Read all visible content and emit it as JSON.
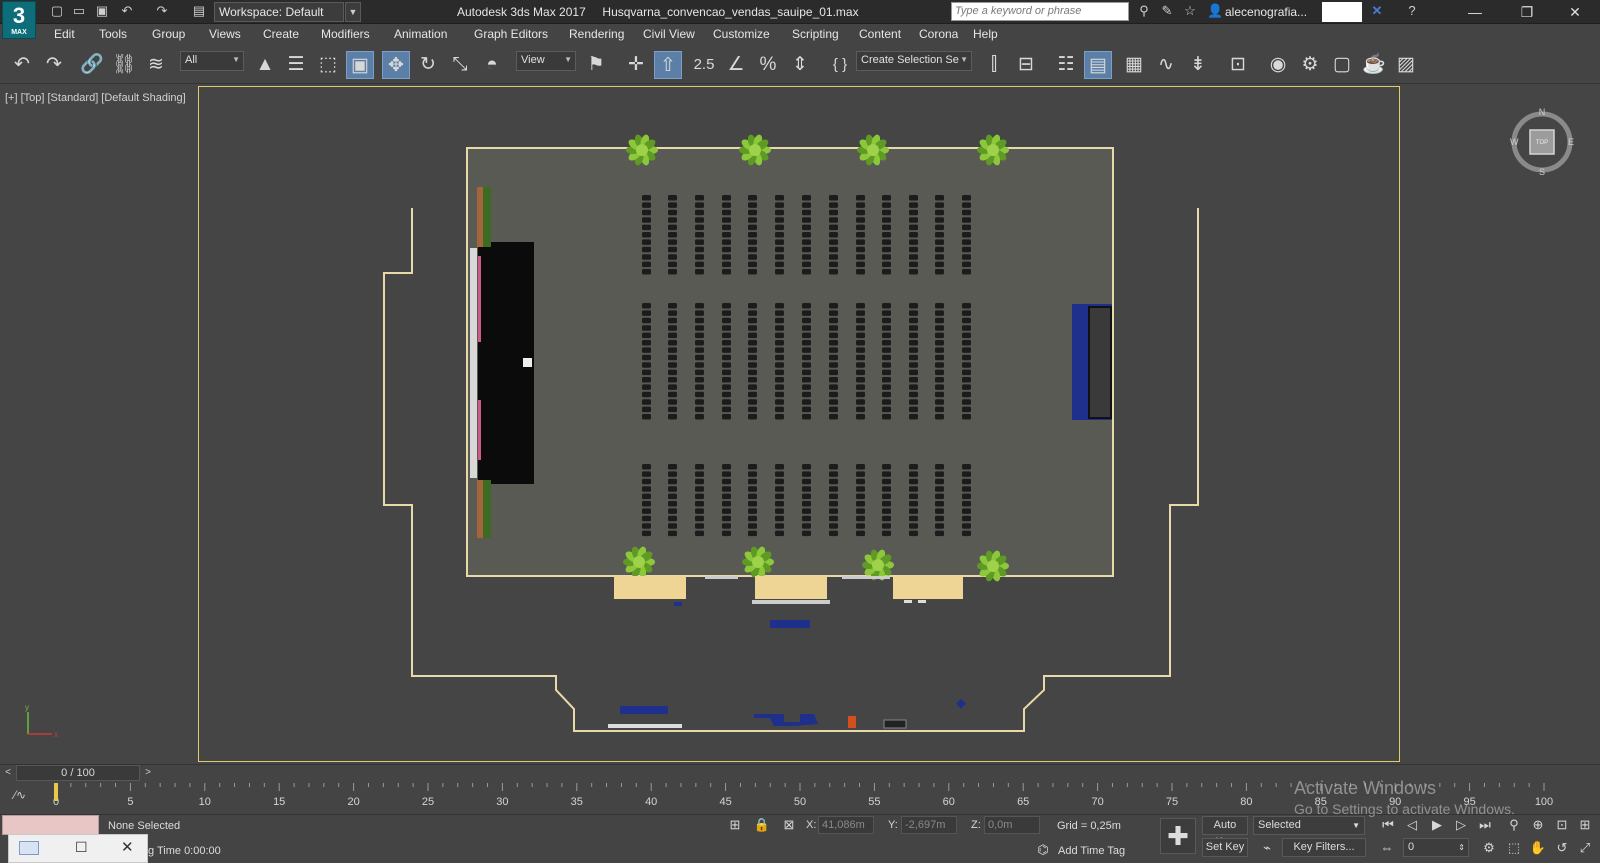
{
  "titlebar": {
    "logo_text": "3",
    "logo_sub": "MAX",
    "workspace": "Workspace: Default",
    "app_title": "Autodesk 3ds Max 2017     Husqvarna_convencao_vendas_sauipe_01.max",
    "search_placeholder": "Type a keyword or phrase",
    "user_name": "alecenografia...",
    "minimize_glyph": "—",
    "restore_glyph": "❐",
    "close_glyph": "✕"
  },
  "menu": [
    "Edit",
    "Tools",
    "Group",
    "Views",
    "Create",
    "Modifiers",
    "Animation",
    "Graph Editors",
    "Rendering",
    "Civil View",
    "Customize",
    "Scripting",
    "Content",
    "Corona",
    "Help"
  ],
  "toolbar": {
    "filter_value": "All",
    "ref_coord_value": "View",
    "selection_set_value": "Create Selection Se",
    "snap_label": "2.5",
    "icons": {
      "undo": "↶",
      "redo": "↷",
      "link": "🔗",
      "unlink": "⛓",
      "bind_space_warp": "≋",
      "select": "▲",
      "select_by_name": "☰",
      "rect_region": "⬚",
      "window_crossing": "▣",
      "move": "✥",
      "rotate": "↻",
      "scale": "⤡",
      "place": "◓",
      "pivot": "⚑",
      "manipulate": "✛",
      "keyboard_shortcut": "⇧",
      "angle_snap": "∠",
      "percent_snap": "%",
      "spinner_snap": "⇕",
      "edit_named_sel": "{ }",
      "mirror": "⫿",
      "align": "⊟",
      "layers": "☷",
      "ribbon": "▤",
      "explorer": "▦",
      "curve_editor": "∿",
      "dope_sheet": "⇟",
      "schematic": "⊡",
      "material_editor": "◉",
      "render_setup": "⚙",
      "rendered_frame": "▢",
      "render": "☕",
      "render_iterative": "☕",
      "render_cloud": "▨"
    }
  },
  "viewport": {
    "label": "[+] [Top] [Standard] [Default Shading]",
    "viewcube": {
      "n": "N",
      "s": "S",
      "e": "E",
      "w": "W",
      "face": "TOP"
    }
  },
  "timeline": {
    "slider_value": "0 / 100",
    "prev_glyph": "<",
    "next_glyph": ">",
    "ticks": [
      "0",
      "5",
      "10",
      "15",
      "20",
      "25",
      "30",
      "35",
      "40",
      "45",
      "50",
      "55",
      "60",
      "65",
      "70",
      "75",
      "80",
      "85",
      "90",
      "95",
      "100"
    ]
  },
  "status": {
    "selection": "None Selected",
    "render_time": "g Time  0:00:00",
    "x_label": "X:",
    "x_value": "41,086m",
    "y_label": "Y:",
    "y_value": "-2,697m",
    "z_label": "Z:",
    "z_value": "0,0m",
    "grid": "Grid = 0,25m",
    "add_time_tag": "Add Time Tag",
    "auto_key": "Auto Key",
    "set_key": "Set Key",
    "selected_dropdown": "Selected",
    "key_filters": "Key Filters...",
    "frame_value": "0"
  },
  "watermark": {
    "line1": "Activate Windows",
    "line2": "Go to Settings to activate Windows."
  },
  "colors": {
    "ui_bg": "#444444",
    "viewport_bg": "#454545",
    "active_border": "#e2cc6a",
    "room_floor": "#5a5a55",
    "room_outline": "#e8d9a8",
    "stage": "#0b0b0b",
    "plant": "#7bb82e",
    "accent_blue": "#1e2f8c"
  }
}
